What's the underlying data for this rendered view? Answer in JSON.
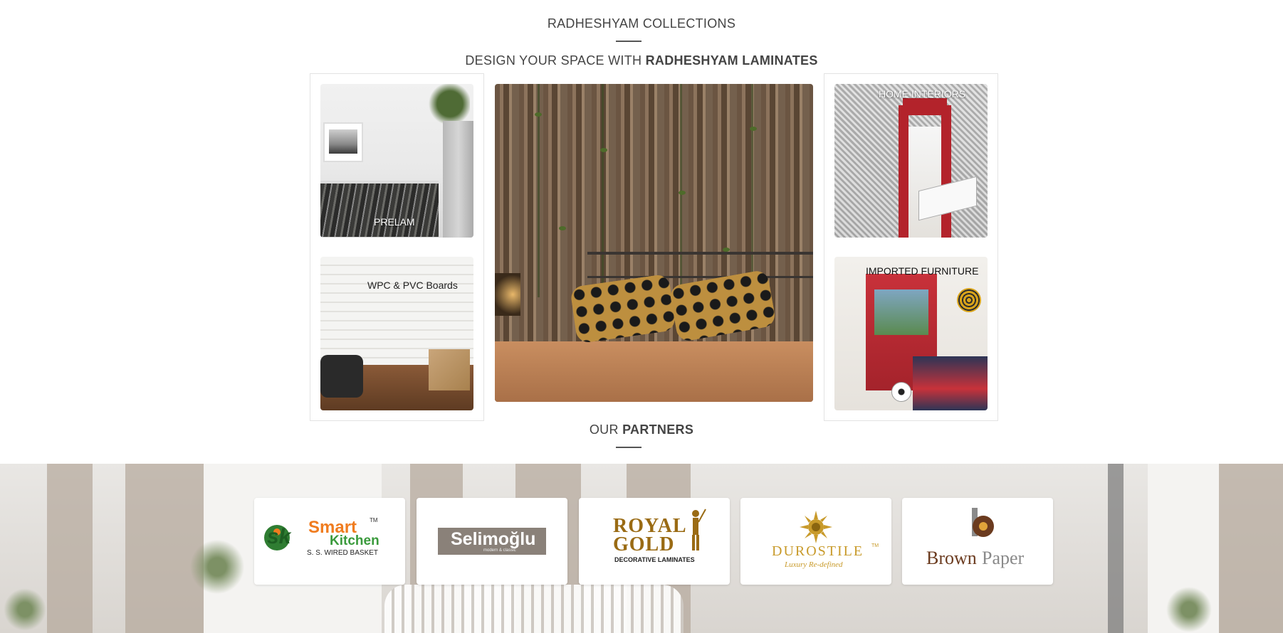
{
  "collections": {
    "heading": "RADHESHYAM COLLECTIONS",
    "tagline_prefix": "DESIGN YOUR SPACE WITH ",
    "tagline_bold": "RADHESHYAM LAMINATES"
  },
  "tiles": {
    "prelam": "PRELAM",
    "wpc": "WPC & PVC Boards",
    "home_interiors": "HOME INTERIORS",
    "imported_furniture": "IMPORTED FURNITURE"
  },
  "partners": {
    "heading_prefix": "OUR ",
    "heading_bold": "PARTNERS",
    "smart_kitchen": {
      "mark": "sk",
      "word1": "Smart",
      "tm": "TM",
      "word2": "Kitchen",
      "sub": "S. S. WIRED BASKET"
    },
    "selimoglu": {
      "name": "Selimoğlu",
      "sub": "modern & classic"
    },
    "royal_gold": {
      "line1": "ROYAL",
      "line2": "GOLD",
      "sub": "DECORATIVE LAMINATES"
    },
    "durostile": {
      "name": "DUROSTILE",
      "tm": "TM",
      "sub": "Luxury Re-defined"
    },
    "brown_paper": {
      "word1": "Brown",
      "word2": "Paper"
    }
  },
  "colors": {
    "text": "#444444",
    "smart_orange": "#f07c1f",
    "smart_green": "#3a9a3c",
    "gold": "#9a6b14",
    "durostile_gold": "#c89a2a",
    "brown": "#6b3b1f"
  }
}
